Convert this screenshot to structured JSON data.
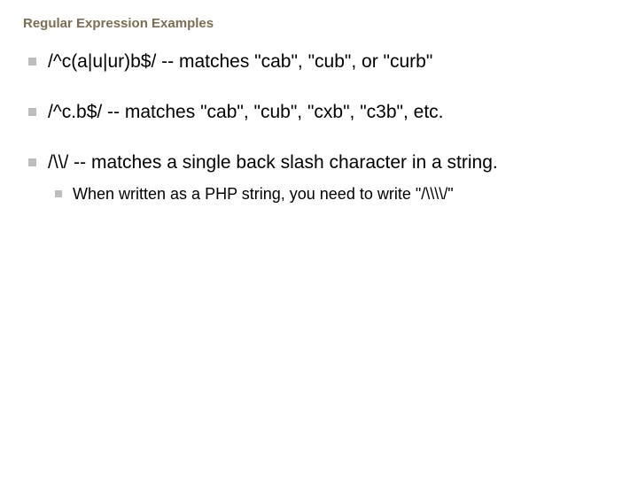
{
  "title": "Regular Expression Examples",
  "bullets": [
    {
      "text": "/^c(a|u|ur)b$/ -- matches \"cab\", \"cub\", or \"curb\""
    },
    {
      "text": "/^c.b$/ -- matches \"cab\", \"cub\", \"cxb\", \"c3b\", etc."
    },
    {
      "text": "/\\\\/ -- matches a single back slash character in a string.",
      "sub": [
        {
          "text": "When written as a PHP string, you need to write \"/\\\\\\\\/\""
        }
      ]
    }
  ]
}
